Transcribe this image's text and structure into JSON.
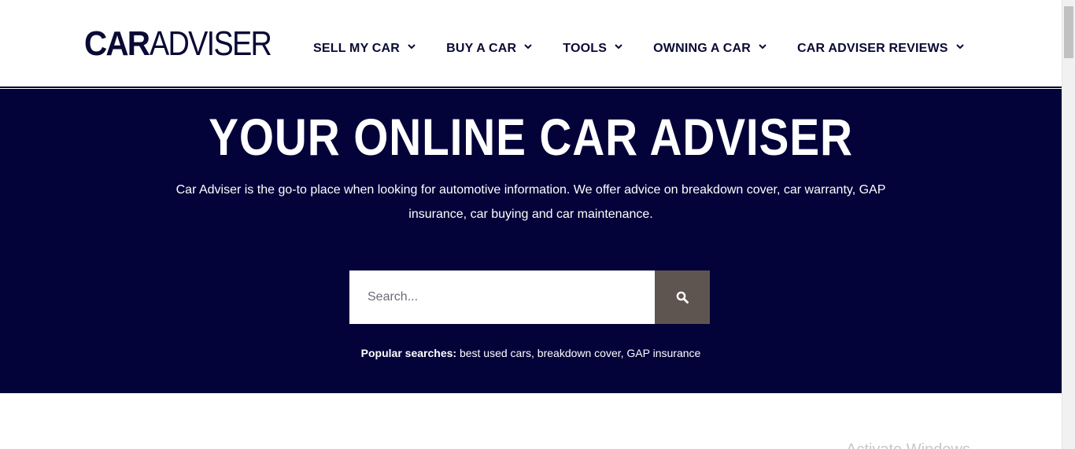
{
  "logo": {
    "bold": "CAR",
    "light": "ADVISER"
  },
  "nav": {
    "items": [
      {
        "label": "SELL MY CAR"
      },
      {
        "label": "BUY A CAR"
      },
      {
        "label": "TOOLS"
      },
      {
        "label": "OWNING A CAR"
      },
      {
        "label": "CAR ADVISER REVIEWS"
      }
    ]
  },
  "hero": {
    "title": "YOUR ONLINE CAR ADVISER",
    "description": "Car Adviser is the go-to place when looking for automotive information. We offer advice on breakdown cover, car warranty, GAP insurance, car buying and car maintenance."
  },
  "search": {
    "placeholder": "Search...",
    "value": ""
  },
  "popular": {
    "label": "Popular searches:",
    "links": [
      "best used cars",
      "breakdown cover",
      "GAP insurance"
    ]
  },
  "watermark": "Activate Windows",
  "colors": {
    "navy": "#03033a",
    "search_button": "#5e5550",
    "text_dark": "#0a0a35"
  },
  "icons": {
    "nav_chevron": "chevron-down-icon",
    "search": "search-icon"
  }
}
